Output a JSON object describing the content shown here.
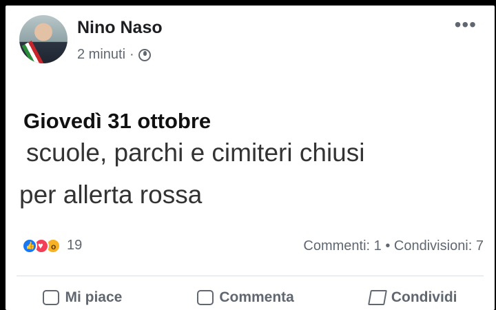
{
  "post": {
    "author": "Nino Naso",
    "time": "2 minuti",
    "separator": "·",
    "date_line": "Giovedì 31 ottobre",
    "line1": "scuole, parchi e cimiteri chiusi",
    "line2": "per allerta rossa"
  },
  "reactions": {
    "count": "19",
    "types": [
      "like-icon",
      "love-icon",
      "wow-icon"
    ]
  },
  "stats": {
    "comments": "Commenti: 1",
    "sep": "•",
    "shares": "Condivisioni: 7"
  },
  "actions": {
    "like": "Mi piace",
    "comment": "Commenta",
    "share": "Condividi"
  },
  "more_glyph": "•••"
}
